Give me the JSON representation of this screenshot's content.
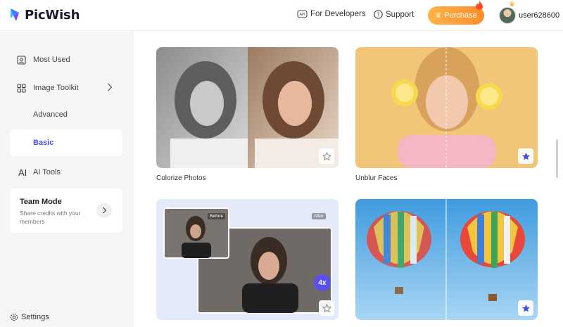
{
  "brand": {
    "name": "PicWish"
  },
  "header": {
    "developers_label": "For Developers",
    "support_label": "Support",
    "purchase_label": "Purchase",
    "username": "user628600"
  },
  "sidebar": {
    "items": [
      {
        "label": "Most Used",
        "icon": "bookmark-icon"
      },
      {
        "label": "Image Toolkit",
        "icon": "grid-icon"
      },
      {
        "label": "Advanced"
      },
      {
        "label": "Basic",
        "active": true
      },
      {
        "label": "AI Tools",
        "icon": "ai-icon",
        "icon_text": "AI"
      }
    ],
    "team": {
      "title": "Team Mode",
      "description": "Share credits with your members"
    },
    "settings_label": "Settings"
  },
  "cards": [
    {
      "label": "Colorize Photos",
      "favorited": false
    },
    {
      "label": "Unblur Faces",
      "favorited": true
    },
    {
      "label": "",
      "before_tag": "Before",
      "after_tag": "After",
      "badge": "4x",
      "favorited": false
    },
    {
      "label": "",
      "favorited": true
    }
  ],
  "colors": {
    "accent": "#4a4ff0",
    "purchase_gradient_start": "#ffb44a",
    "purchase_gradient_end": "#ff8d2a",
    "sidebar_bg": "#f5f5f7"
  }
}
